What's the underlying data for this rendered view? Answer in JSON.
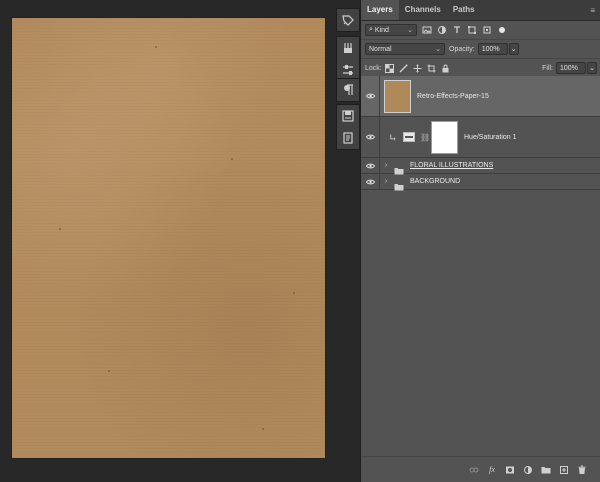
{
  "panel": {
    "tabs": [
      {
        "label": "Layers",
        "active": true
      },
      {
        "label": "Channels",
        "active": false
      },
      {
        "label": "Paths",
        "active": false
      }
    ],
    "filter": {
      "kind_label": "Kind"
    },
    "blend_mode": "Normal",
    "opacity_label": "Opacity:",
    "opacity_value": "100%",
    "lock_label": "Lock:",
    "fill_label": "Fill:",
    "fill_value": "100%"
  },
  "layers": [
    {
      "name": "Retro-Effects-Paper-15",
      "type": "image",
      "visible": true,
      "selected": true
    },
    {
      "name": "Hue/Saturation 1",
      "type": "adjustment",
      "visible": true,
      "clipped": true
    },
    {
      "name": "FLORAL ILLUSTRATIONS",
      "type": "group",
      "visible": true
    },
    {
      "name": "BACKGROUND",
      "type": "group",
      "visible": true
    }
  ],
  "colors": {
    "paper": "#b0895a",
    "panel_bg": "#535353",
    "workspace_bg": "#282828",
    "selected_layer": "#666666"
  },
  "tools": [
    "history-brush-icon",
    "brush-settings-icon",
    "adjust-sliders-icon",
    "paragraph-icon",
    "save-icon",
    "document-icon"
  ]
}
